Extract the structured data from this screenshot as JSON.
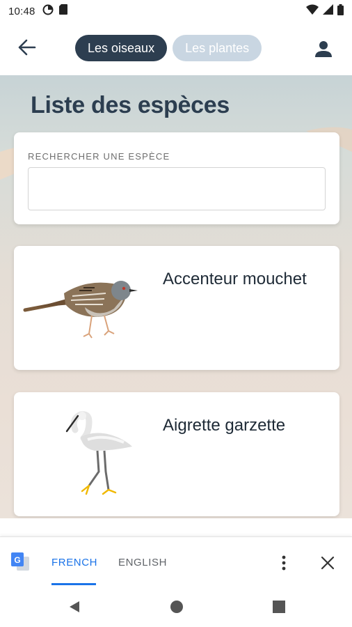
{
  "status_bar": {
    "time": "10:48",
    "left_icons": [
      "data-saver-icon",
      "sd-card-icon"
    ],
    "right_icons": [
      "wifi-icon",
      "signal-icon",
      "battery-icon"
    ]
  },
  "app_bar": {
    "back_icon": "arrow-back-icon",
    "tabs": [
      {
        "label": "Les oiseaux",
        "active": true
      },
      {
        "label": "Les plantes",
        "active": false
      }
    ],
    "profile_icon": "person-icon"
  },
  "main": {
    "title": "Liste des espèces",
    "search": {
      "label": "RECHERCHER UNE ESPÈCE",
      "value": "",
      "placeholder": ""
    },
    "species": [
      {
        "name": "Accenteur mouchet",
        "image": "dunnock-bird-illustration"
      },
      {
        "name": "Aigrette garzette",
        "image": "little-egret-illustration"
      }
    ]
  },
  "translate_bar": {
    "icon": "google-translate-icon",
    "languages": [
      {
        "label": "FRENCH",
        "selected": true
      },
      {
        "label": "ENGLISH",
        "selected": false
      }
    ],
    "more_icon": "more-vert-icon",
    "close_icon": "close-icon"
  },
  "nav_bar": {
    "buttons": [
      "nav-back-icon",
      "nav-home-icon",
      "nav-recents-icon"
    ]
  },
  "colors": {
    "primary_dark": "#2d3e50",
    "tab_inactive": "#c9d6e2",
    "translate_accent": "#1a73e8"
  }
}
